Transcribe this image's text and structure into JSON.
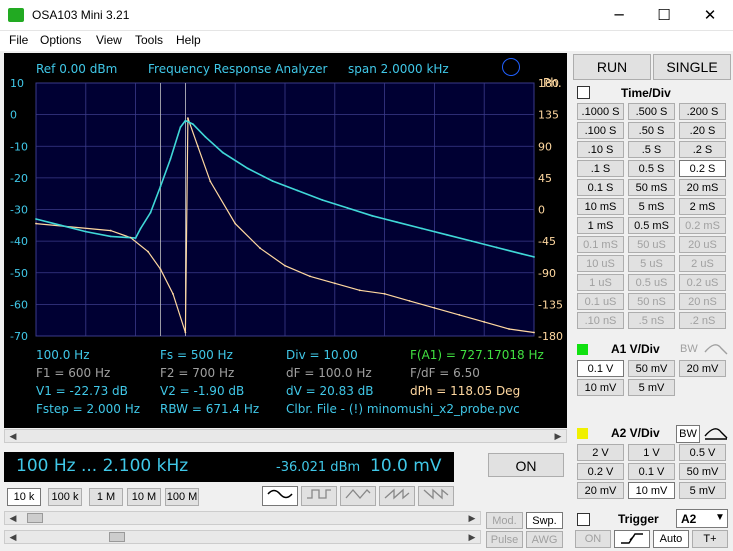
{
  "window": {
    "title": "OSA103 Mini 3.21",
    "minimize": "─",
    "maximize": "☐",
    "close": "✕"
  },
  "menu": [
    "File",
    "Options",
    "View",
    "Tools",
    "Help"
  ],
  "plot": {
    "ref": "Ref  0.00 dBm",
    "mode": "Frequency Response Analyzer",
    "span": "span 2.0000 kHz",
    "left_ticks": [
      "10",
      "0",
      "-10",
      "-20",
      "-30",
      "-40",
      "-50",
      "-60",
      "-70"
    ],
    "right_title": "Ph.",
    "right_ticks": [
      "180",
      "135",
      "90",
      "45",
      "0",
      "-45",
      "-90",
      "-135",
      "-180"
    ],
    "colors": {
      "bg": "#000033",
      "grid": "#3a3a8a",
      "amp": "#40d8d8",
      "phase": "#ffd8a0",
      "text": "#40c8e8",
      "green": "#40e040",
      "gray": "#a0a0a0"
    }
  },
  "chart_data": {
    "type": "line",
    "xlim": [
      100,
      2100
    ],
    "ylim": [
      -70,
      10
    ],
    "y2lim": [
      -180,
      180
    ],
    "series": [
      {
        "points": [
          [
            100,
            -33
          ],
          [
            200,
            -35
          ],
          [
            300,
            -37
          ],
          [
            400,
            -38.5
          ],
          [
            500,
            -39
          ],
          [
            520,
            -36
          ],
          [
            560,
            -31
          ],
          [
            600,
            -22.7
          ],
          [
            640,
            -14
          ],
          [
            680,
            -4
          ],
          [
            700,
            -1.9
          ],
          [
            730,
            -3
          ],
          [
            780,
            -7
          ],
          [
            850,
            -12
          ],
          [
            950,
            -17
          ],
          [
            1050,
            -21
          ],
          [
            1150,
            -24
          ],
          [
            1250,
            -27
          ],
          [
            1350,
            -29.5
          ],
          [
            1450,
            -32
          ],
          [
            1550,
            -34
          ],
          [
            1650,
            -36
          ],
          [
            1750,
            -38
          ],
          [
            1850,
            -40
          ],
          [
            1950,
            -42
          ],
          [
            2050,
            -44
          ],
          [
            2100,
            -45
          ]
        ]
      },
      {
        "points": [
          [
            100,
            -20
          ],
          [
            400,
            -30
          ],
          [
            480,
            -40
          ],
          [
            550,
            -60
          ],
          [
            600,
            -85
          ],
          [
            650,
            -120
          ],
          [
            700,
            -175
          ],
          [
            710,
            130
          ],
          [
            750,
            90
          ],
          [
            800,
            40
          ],
          [
            900,
            -20
          ],
          [
            1000,
            -55
          ],
          [
            1100,
            -80
          ],
          [
            1200,
            -95
          ],
          [
            1300,
            -105
          ],
          [
            1400,
            -115
          ],
          [
            1500,
            -120
          ],
          [
            1600,
            -130
          ],
          [
            1700,
            -140
          ],
          [
            1800,
            -150
          ],
          [
            1900,
            -160
          ],
          [
            2000,
            -170
          ],
          [
            2100,
            -175
          ]
        ]
      }
    ]
  },
  "readouts": {
    "r1": [
      "100.0 Hz",
      "Fs = 500 Hz",
      "Div = 10.00",
      "F(A1) = 727.17018 Hz"
    ],
    "r2": [
      "F1 = 600 Hz",
      "F2 = 700 Hz",
      "dF = 100.0 Hz",
      "F/dF = 6.50"
    ],
    "r3": [
      "V1 = -22.73 dB",
      "V2 = -1.90 dB",
      "dV = 20.83 dB",
      "dPh = 118.05 Deg"
    ],
    "r4": [
      "Fstep = 2.000 Hz",
      "RBW = 671.4 Hz",
      "Clbr. File - (!) minomushi_x2_probe.pvc"
    ]
  },
  "status": {
    "range": "100 Hz  ...  2.100 kHz",
    "level": "-36.021 dBm",
    "volt": "10.0 mV",
    "on": "ON"
  },
  "ranges": [
    "10 k",
    "100 k",
    "1 M",
    "10 M",
    "100 M"
  ],
  "wave_buttons": [
    "sine-icon",
    "square-icon",
    "triangle-icon",
    "saw-up-icon",
    "saw-down-icon"
  ],
  "mod": "Mod.",
  "swp": "Swp.",
  "pulse": "Pulse",
  "awg": "AWG",
  "run": "RUN",
  "single": "SINGLE",
  "timediv": {
    "label": "Time/Div",
    "buttons": [
      [
        ".1000 S",
        ".500 S",
        ".200 S"
      ],
      [
        ".100 S",
        ".50 S",
        ".20 S"
      ],
      [
        ".10 S",
        ".5 S",
        ".2 S"
      ],
      [
        ".1 S",
        "0.5 S",
        "0.2 S"
      ],
      [
        "0.1 S",
        "50 mS",
        "20 mS"
      ],
      [
        "10 mS",
        "5 mS",
        "2 mS"
      ],
      [
        "1 mS",
        "0.5 mS",
        "0.2 mS"
      ],
      [
        "0.1 mS",
        "50 uS",
        "20 uS"
      ],
      [
        "10 uS",
        "5 uS",
        "2 uS"
      ],
      [
        "1 uS",
        "0.5 uS",
        "0.2 uS"
      ],
      [
        "0.1 uS",
        "50 nS",
        "20 nS"
      ],
      [
        ".10 nS",
        ".5 nS",
        ".2 nS"
      ]
    ]
  },
  "a1": {
    "label": "A1 V/Div",
    "bw": "BW",
    "buttons": [
      [
        "0.1 V",
        "50 mV",
        "20 mV"
      ],
      [
        "10 mV",
        "5 mV"
      ]
    ]
  },
  "a2": {
    "label": "A2 V/Div",
    "bw": "BW",
    "buttons": [
      [
        "2 V",
        "1 V",
        "0.5 V"
      ],
      [
        "0.2 V",
        "0.1 V",
        "50 mV"
      ],
      [
        "20 mV",
        "10 mV",
        "5 mV"
      ]
    ]
  },
  "trigger": {
    "label": "Trigger",
    "source": "A2",
    "on": "ON",
    "auto": "Auto",
    "tplus": "T+"
  }
}
